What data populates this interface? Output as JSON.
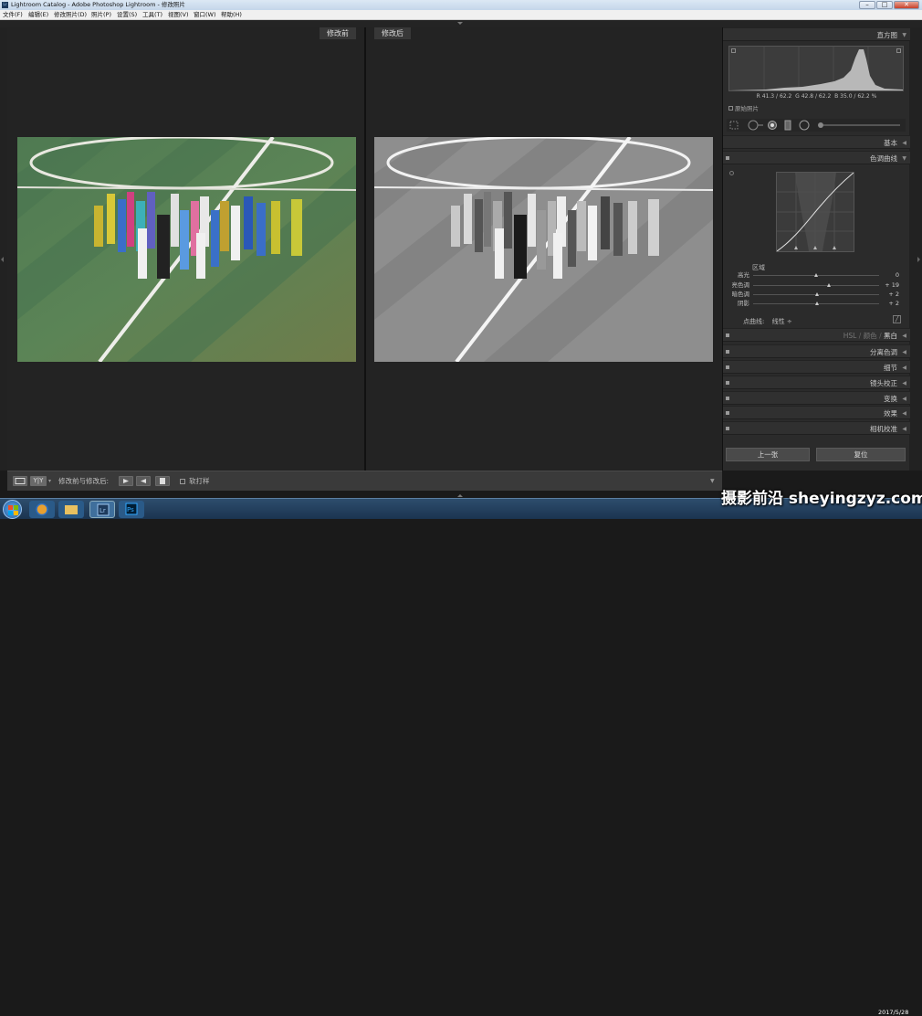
{
  "window": {
    "title": "Lightroom Catalog - Adobe Photoshop Lightroom - 修改照片",
    "logo": "Lr",
    "minimize": "–",
    "maximize": "□",
    "close": "✕"
  },
  "menu": [
    "文件(F)",
    "编辑(E)",
    "修改照片(D)",
    "照片(P)",
    "设置(S)",
    "工具(T)",
    "视图(V)",
    "窗口(W)",
    "帮助(H)"
  ],
  "viewer": {
    "before_label": "修改前",
    "after_label": "修改后"
  },
  "toolbar": {
    "view_toggle": "Y|Y",
    "compare_label": "修改前与修改后:",
    "soft_proof": "软打样"
  },
  "histogram": {
    "title": "直方图",
    "readout": {
      "r": "R",
      "r_val": "41.3 / 62.2",
      "g": "G",
      "g_val": "42.8 / 62.2",
      "b": "B",
      "b_val": "35.0 / 62.2",
      "unit": "%"
    },
    "original_photo": "原始照片"
  },
  "panels": {
    "basic": "基本",
    "tone_curve": "色调曲线",
    "hsl": "HSL",
    "color": "颜色",
    "bw": "黑白",
    "split_toning": "分离色调",
    "detail": "细节",
    "lens": "镜头校正",
    "transform": "变换",
    "effects": "效果",
    "camera": "相机校准"
  },
  "tone_curve": {
    "region": "区域",
    "sliders": [
      {
        "label": "高光",
        "value": "0",
        "level": 0.5
      },
      {
        "label": "亮色调",
        "value": "+ 19",
        "level": 0.6
      },
      {
        "label": "暗色调",
        "value": "+ 2",
        "level": 0.51
      },
      {
        "label": "阴影",
        "value": "+ 2",
        "level": 0.51
      }
    ],
    "point_curve_label": "点曲线:",
    "point_curve_value": "线性 ÷"
  },
  "buttons": {
    "prev": "上一张",
    "reset": "复位"
  },
  "taskbar": {
    "clock": "2017/5/28"
  },
  "watermark": "摄影前沿 sheyingzyz.com"
}
